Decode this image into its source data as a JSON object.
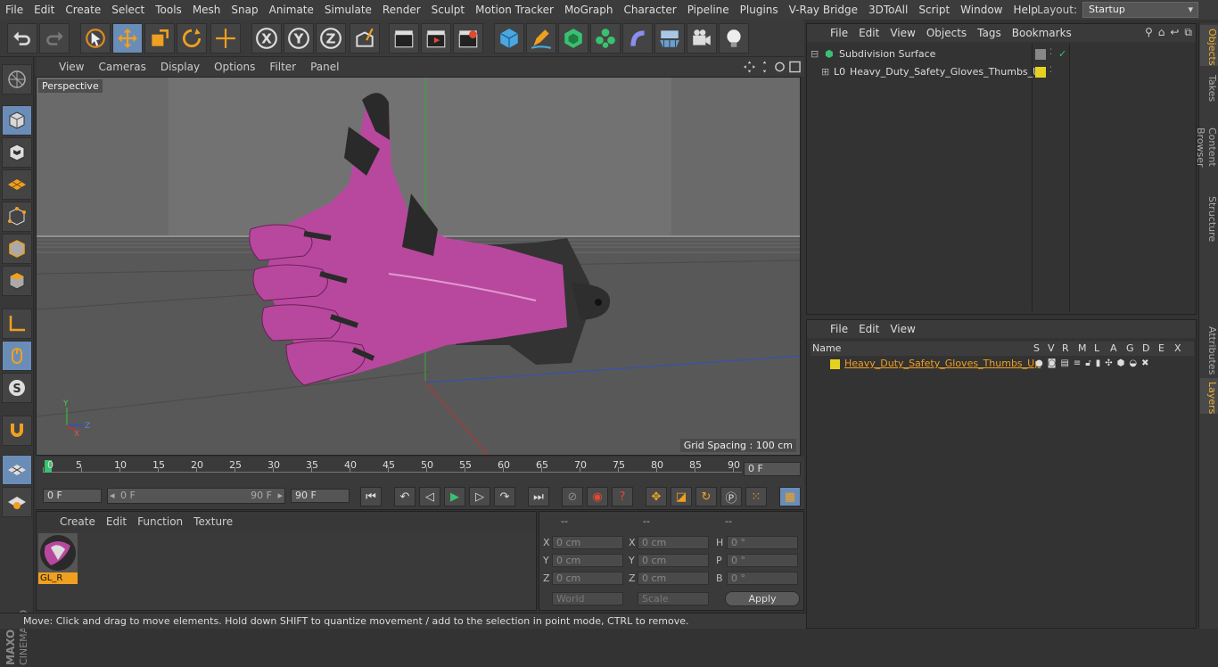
{
  "menubar": {
    "items": [
      "File",
      "Edit",
      "Create",
      "Select",
      "Tools",
      "Mesh",
      "Snap",
      "Animate",
      "Simulate",
      "Render",
      "Sculpt",
      "Motion Tracker",
      "MoGraph",
      "Character",
      "Pipeline",
      "Plugins",
      "V-Ray Bridge",
      "3DToAll",
      "Script",
      "Window",
      "Help"
    ],
    "layout_label": "Layout:",
    "layout_value": "Startup"
  },
  "viewport": {
    "menu": [
      "View",
      "Cameras",
      "Display",
      "Options",
      "Filter",
      "Panel"
    ],
    "label": "Perspective",
    "grid_spacing": "Grid Spacing : 100 cm"
  },
  "timeline": {
    "ticks": [
      "0",
      "5",
      "10",
      "15",
      "20",
      "25",
      "30",
      "35",
      "40",
      "45",
      "50",
      "55",
      "60",
      "65",
      "70",
      "75",
      "80",
      "85",
      "90"
    ],
    "current_frame": "0 F"
  },
  "transport": {
    "start_frame": "0 F",
    "range_start": "0 F",
    "range_end": "90 F",
    "end_frame": "90 F"
  },
  "materials": {
    "menu": [
      "Create",
      "Edit",
      "Function",
      "Texture"
    ],
    "items": [
      {
        "name": "GL_R"
      }
    ]
  },
  "coords": {
    "headers": [
      "--",
      "--",
      "--"
    ],
    "rows": [
      {
        "l1": "X",
        "v1": "0 cm",
        "l2": "X",
        "v2": "0 cm",
        "l3": "H",
        "v3": "0 °"
      },
      {
        "l1": "Y",
        "v1": "0 cm",
        "l2": "Y",
        "v2": "0 cm",
        "l3": "P",
        "v3": "0 °"
      },
      {
        "l1": "Z",
        "v1": "0 cm",
        "l2": "Z",
        "v2": "0 cm",
        "l3": "B",
        "v3": "0 °"
      }
    ],
    "mode": "World",
    "size_mode": "Scale",
    "apply": "Apply"
  },
  "status": "Move: Click and drag to move elements. Hold down SHIFT to quantize movement / add to the selection in point mode, CTRL to remove.",
  "objects": {
    "menu": [
      "File",
      "Edit",
      "View",
      "Objects",
      "Tags",
      "Bookmarks"
    ],
    "items": [
      {
        "name": "Subdivision Surface"
      },
      {
        "name": "Heavy_Duty_Safety_Gloves_Thumbs_Up"
      }
    ]
  },
  "layers": {
    "menu": [
      "File",
      "Edit",
      "View"
    ],
    "columns": [
      "Name",
      "S",
      "V",
      "R",
      "M",
      "L",
      "A",
      "G",
      "D",
      "E",
      "X"
    ],
    "items": [
      {
        "name": "Heavy_Duty_Safety_Gloves_Thumbs_Up",
        "color": "#e6d21e"
      }
    ]
  },
  "side_tabs": [
    "Objects",
    "Takes",
    "Content Browser",
    "Structure",
    "Attributes",
    "Layers"
  ],
  "colors": {
    "accent": "#6a8db8",
    "highlight": "#f0b030",
    "glove_pink": "#b8489e",
    "layer_yellow": "#e6d21e"
  }
}
